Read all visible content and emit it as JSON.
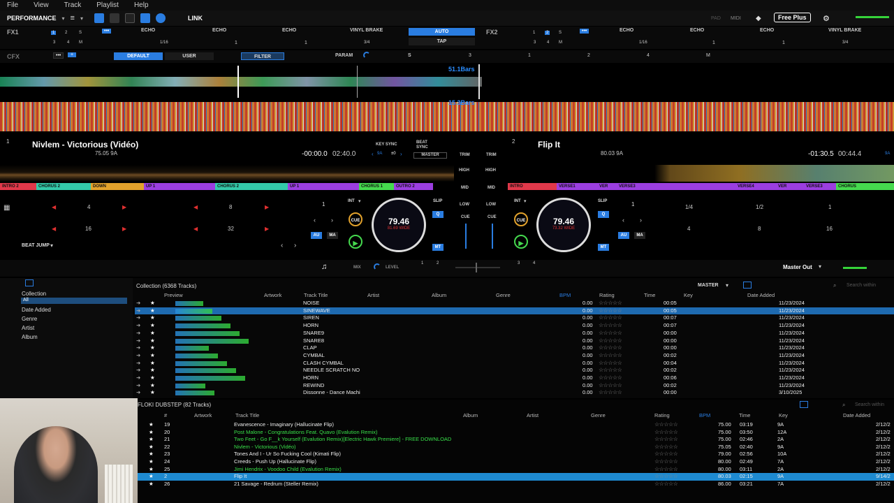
{
  "menu": [
    "File",
    "View",
    "Track",
    "Playlist",
    "Help"
  ],
  "topbar": {
    "mode": "PERFORMANCE",
    "link": "LINK",
    "pad": "PAD",
    "midi": "MIDI",
    "plan": "Free Plus"
  },
  "fx1": {
    "label": "FX1",
    "beats": [
      "1",
      "2",
      "S",
      "3",
      "4",
      "M"
    ],
    "fraction": "1/16",
    "effects": [
      "ECHO",
      "ECHO",
      "ECHO"
    ],
    "values": [
      "1",
      "1",
      "1"
    ],
    "vinyl": "VINYL BRAKE",
    "vinyl_frac": "3/4",
    "auto": "AUTO",
    "tap": "TAP"
  },
  "fx2": {
    "label": "FX2",
    "beats": [
      "1",
      "2",
      "S",
      "3",
      "4",
      "M"
    ],
    "fraction": "1/16",
    "effects": [
      "ECHO",
      "ECHO",
      "ECHO"
    ],
    "values": [
      "1",
      "1",
      "1"
    ],
    "vinyl": "VINYL BRAKE",
    "vinyl_frac": "3/4"
  },
  "cfx": {
    "label": "CFX",
    "default": "DEFAULT",
    "user": "USER",
    "filter": "FILTER",
    "param": "PARAM",
    "s": "S",
    "nums": [
      "3",
      "1",
      "2",
      "4",
      "M"
    ]
  },
  "overview": {
    "bars1": "51.1Bars",
    "bars2": "15.3Bars"
  },
  "deck1": {
    "num": "1",
    "title": "Nivlem - Victorious (Vidéo)",
    "bpm_key": "75.05  9A",
    "elapsed": "-00:00.0",
    "total": "02:40.0",
    "keysync": "KEY SYNC",
    "beatsync": "BEAT SYNC",
    "master": "MASTER",
    "key_small": "9A",
    "pm": "±0",
    "cues": [
      {
        "label": "INTRO 2",
        "color": "#e0384a"
      },
      {
        "label": "CHORUS 2",
        "color": "#33c9a9"
      },
      {
        "label": "DOWN",
        "color": "#e2a22c"
      },
      {
        "label": "UP 1",
        "color": "#9b3ee0"
      },
      {
        "label": "CHORUS 2",
        "color": "#33c9a9"
      },
      {
        "label": "UP 1",
        "color": "#9b3ee0"
      },
      {
        "label": "CHORUS 1",
        "color": "#45d94e"
      },
      {
        "label": "OUTRO 2",
        "color": "#9b3ee0"
      }
    ],
    "pads": [
      "4",
      "8",
      "16",
      "32"
    ],
    "beatjump": "BEAT JUMP",
    "bpm_display": "79.46",
    "bpm_sub": "81.69  WIDE",
    "int": "INT",
    "cue": "CUE",
    "slip": "SLIP",
    "q": "Q",
    "au": "AU",
    "ma": "MA",
    "mt": "MT",
    "one": "1"
  },
  "deck2": {
    "num": "2",
    "title": "Flip It",
    "bpm_key": "80.03  9A",
    "elapsed": "-01:30.5",
    "total": "00:44.4",
    "key_small": "9A",
    "cues": [
      {
        "label": "INTRO",
        "color": "#e0384a"
      },
      {
        "label": "VERSE1",
        "color": "#9b3ee0"
      },
      {
        "label": "VER",
        "color": "#9b3ee0"
      },
      {
        "label": "VERSE3",
        "color": "#9b3ee0"
      },
      {
        "label": "VERSE4",
        "color": "#9b3ee0"
      },
      {
        "label": "VER",
        "color": "#9b3ee0"
      },
      {
        "label": "VERSE3",
        "color": "#9b3ee0"
      },
      {
        "label": "CHORUS",
        "color": "#45d94e"
      }
    ],
    "pads": [
      "1/4",
      "1/2",
      "1",
      "4",
      "8",
      "16"
    ],
    "bpm_display": "79.46",
    "bpm_sub": "73.32  WIDE",
    "int": "INT",
    "cue": "CUE",
    "slip": "SLIP",
    "q": "Q",
    "au": "AU",
    "ma": "MA",
    "mt": "MT",
    "one": "1"
  },
  "mixer": {
    "trim": "TRIM",
    "high": "HIGH",
    "mid": "MID",
    "low": "LOW",
    "cue": "CUE"
  },
  "midbar": {
    "mix": "MIX",
    "level": "LEVEL",
    "master_out": "Master Out",
    "nums": [
      "1",
      "2",
      "3",
      "4"
    ]
  },
  "sidebar": {
    "items": [
      "Collection",
      "All",
      "Date Added",
      "Genre",
      "Artist",
      "Album"
    ]
  },
  "collection": {
    "title": "Collection (6368 Tracks)",
    "master": "MASTER",
    "search_placeholder": "Search within",
    "headers": [
      "Preview",
      "Artwork",
      "Track Title",
      "Artist",
      "Album",
      "Genre",
      "BPM",
      "Rating",
      "Time",
      "Key",
      "Date Added"
    ],
    "rows": [
      {
        "title": "NOISE",
        "bpm": "0.00",
        "time": "00:05",
        "date": "11/23/2024",
        "sel": false
      },
      {
        "title": "SINEWAVE",
        "bpm": "0.00",
        "time": "00:05",
        "date": "11/23/2024",
        "sel": true
      },
      {
        "title": "SIREN",
        "bpm": "0.00",
        "time": "00:07",
        "date": "11/23/2024",
        "sel": false
      },
      {
        "title": "HORN",
        "bpm": "0.00",
        "time": "00:07",
        "date": "11/23/2024",
        "sel": false
      },
      {
        "title": "SNARE9",
        "bpm": "0.00",
        "time": "00:00",
        "date": "11/23/2024",
        "sel": false
      },
      {
        "title": "SNARE8",
        "bpm": "0.00",
        "time": "00:00",
        "date": "11/23/2024",
        "sel": false
      },
      {
        "title": "CLAP",
        "bpm": "0.00",
        "time": "00:00",
        "date": "11/23/2024",
        "sel": false
      },
      {
        "title": "CYMBAL",
        "bpm": "0.00",
        "time": "00:02",
        "date": "11/23/2024",
        "sel": false
      },
      {
        "title": "CLASH CYMBAL",
        "bpm": "0.00",
        "time": "00:04",
        "date": "11/23/2024",
        "sel": false
      },
      {
        "title": "NEEDLE SCRATCH NO",
        "bpm": "0.00",
        "time": "00:02",
        "date": "11/23/2024",
        "sel": false
      },
      {
        "title": "HORN",
        "bpm": "0.00",
        "time": "00:06",
        "date": "11/23/2024",
        "sel": false
      },
      {
        "title": "REWIND",
        "bpm": "0.00",
        "time": "00:02",
        "date": "11/23/2024",
        "sel": false
      },
      {
        "title": "Dissonne - Dance Machi",
        "bpm": "0.00",
        "time": "00:00",
        "date": "3/10/2025",
        "sel": false
      }
    ]
  },
  "playlist": {
    "title": "FLOKI DUBSTEP (82 Tracks)",
    "search_placeholder": "Search within",
    "headers": [
      "#",
      "Artwork",
      "Track Title",
      "Album",
      "Artist",
      "Genre",
      "Rating",
      "BPM",
      "Time",
      "Key",
      "Date Added"
    ],
    "rows": [
      {
        "num": "19",
        "title": "Evanescence - Imaginary (Hallucinate Flip)",
        "bpm": "75.00",
        "time": "03:19",
        "key": "9A",
        "date": "2/12/2",
        "green": false,
        "sel": false
      },
      {
        "num": "20",
        "title": "Post Malone - Congratulations Feat. Quavo (Evalution Remix)",
        "bpm": "75.00",
        "time": "03:50",
        "key": "12A",
        "date": "2/12/2",
        "green": true,
        "sel": false
      },
      {
        "num": "21",
        "title": "Two Feet - Go F__k Yourself (Evalution Remix)[Electric Hawk Premiere] - FREE DOWNLOAD",
        "bpm": "75.00",
        "time": "02:46",
        "key": "2A",
        "date": "2/12/2",
        "green": true,
        "sel": false
      },
      {
        "num": "22",
        "title": "Nivlem - Victorious (Vidéo)",
        "bpm": "75.05",
        "time": "02:40",
        "key": "9A",
        "date": "2/12/2",
        "green": true,
        "sel": false
      },
      {
        "num": "23",
        "title": "Tones And I - Ur So Fucking Cool (Kimati Flip)",
        "bpm": "79.00",
        "time": "02:56",
        "key": "10A",
        "date": "2/12/2",
        "green": false,
        "sel": false
      },
      {
        "num": "24",
        "title": "Creeds - Push Up (Hallucinate Flip)",
        "bpm": "80.00",
        "time": "02:49",
        "key": "7A",
        "date": "2/12/2",
        "green": false,
        "sel": false
      },
      {
        "num": "25",
        "title": "Jimi Hendrix - Voodoo Child (Evalution Remix)",
        "bpm": "80.00",
        "time": "03:11",
        "key": "2A",
        "date": "2/12/2",
        "green": true,
        "sel": false
      },
      {
        "num": "2",
        "title": "Flip It",
        "bpm": "80.03",
        "time": "02:15",
        "key": "9A",
        "date": "9/14/2",
        "green": false,
        "sel": true
      },
      {
        "num": "26",
        "title": "21 Savage - Redrum (Steller Remix)",
        "bpm": "86.00",
        "time": "03:21",
        "key": "7A",
        "date": "2/12/2",
        "green": false,
        "sel": false
      }
    ]
  }
}
